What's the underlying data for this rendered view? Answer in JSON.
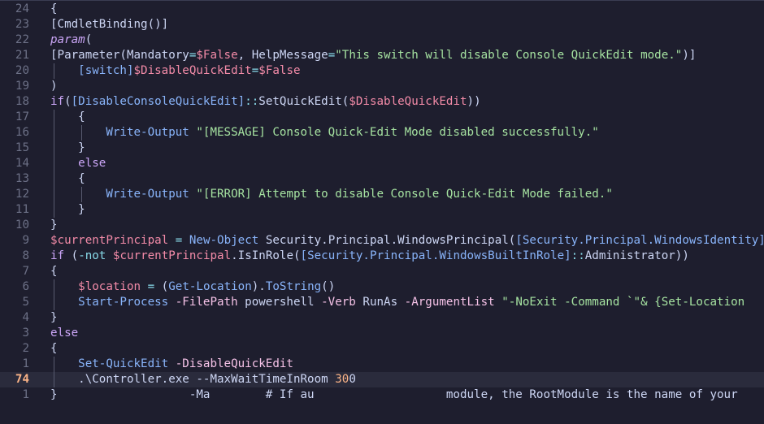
{
  "editor": {
    "colors": {
      "background": "#1e1e2e",
      "keyword": "#cba6f7",
      "type": "#89b4fa",
      "variable": "#f38ba8",
      "string": "#a6e3a1",
      "number": "#fab387",
      "current_line": "#2a2b3c"
    },
    "lines": [
      {
        "num": "24",
        "guides": [],
        "tokens": [
          {
            "t": "{",
            "c": "plain"
          }
        ]
      },
      {
        "num": "23",
        "guides": [],
        "tokens": [
          {
            "t": "[CmdletBinding()]",
            "c": "plain"
          }
        ]
      },
      {
        "num": "22",
        "guides": [],
        "tokens": [
          {
            "t": "param",
            "c": "kwi"
          },
          {
            "t": "(",
            "c": "plain"
          }
        ]
      },
      {
        "num": "21",
        "guides": [],
        "tokens": [
          {
            "t": "[Parameter(Mandatory",
            "c": "plain"
          },
          {
            "t": "=",
            "c": "op"
          },
          {
            "t": "$False",
            "c": "var"
          },
          {
            "t": ", HelpMessage",
            "c": "plain"
          },
          {
            "t": "=",
            "c": "op"
          },
          {
            "t": "\"This switch will disable Console QuickEdit mode.\"",
            "c": "str"
          },
          {
            "t": ")]",
            "c": "plain"
          }
        ]
      },
      {
        "num": "20",
        "guides": [
          1
        ],
        "tokens": [
          {
            "t": "    ",
            "c": "plain"
          },
          {
            "t": "[switch]",
            "c": "type"
          },
          {
            "t": "$DisableQuickEdit",
            "c": "var"
          },
          {
            "t": "=",
            "c": "op"
          },
          {
            "t": "$False",
            "c": "var"
          }
        ]
      },
      {
        "num": "19",
        "guides": [],
        "tokens": [
          {
            "t": ")",
            "c": "plain"
          }
        ]
      },
      {
        "num": "18",
        "guides": [],
        "tokens": [
          {
            "t": "if",
            "c": "kw"
          },
          {
            "t": "(",
            "c": "plain"
          },
          {
            "t": "[DisableConsoleQuickEdit]",
            "c": "type"
          },
          {
            "t": "::",
            "c": "op"
          },
          {
            "t": "SetQuickEdit(",
            "c": "plain"
          },
          {
            "t": "$DisableQuickEdit",
            "c": "var"
          },
          {
            "t": "))",
            "c": "plain"
          }
        ]
      },
      {
        "num": "17",
        "guides": [
          1
        ],
        "tokens": [
          {
            "t": "    {",
            "c": "plain"
          }
        ]
      },
      {
        "num": "16",
        "guides": [
          1,
          2
        ],
        "tokens": [
          {
            "t": "        ",
            "c": "plain"
          },
          {
            "t": "Write-Output",
            "c": "cmd"
          },
          {
            "t": " ",
            "c": "plain"
          },
          {
            "t": "\"[MESSAGE] Console Quick-Edit Mode disabled successfully.\"",
            "c": "str"
          }
        ]
      },
      {
        "num": "15",
        "guides": [
          1
        ],
        "tokens": [
          {
            "t": "    }",
            "c": "plain"
          }
        ]
      },
      {
        "num": "14",
        "guides": [
          1
        ],
        "tokens": [
          {
            "t": "    ",
            "c": "plain"
          },
          {
            "t": "else",
            "c": "kw"
          }
        ]
      },
      {
        "num": "13",
        "guides": [
          1
        ],
        "tokens": [
          {
            "t": "    {",
            "c": "plain"
          }
        ]
      },
      {
        "num": "12",
        "guides": [
          1,
          2
        ],
        "tokens": [
          {
            "t": "        ",
            "c": "plain"
          },
          {
            "t": "Write-Output",
            "c": "cmd"
          },
          {
            "t": " ",
            "c": "plain"
          },
          {
            "t": "\"[ERROR] Attempt to disable Console Quick-Edit Mode failed.\"",
            "c": "str"
          }
        ]
      },
      {
        "num": "11",
        "guides": [
          1
        ],
        "tokens": [
          {
            "t": "    }",
            "c": "plain"
          }
        ]
      },
      {
        "num": "10",
        "guides": [],
        "tokens": [
          {
            "t": "}",
            "c": "plain"
          }
        ]
      },
      {
        "num": "9",
        "guides": [],
        "tokens": [
          {
            "t": "$currentPrincipal",
            "c": "var"
          },
          {
            "t": " ",
            "c": "plain"
          },
          {
            "t": "=",
            "c": "op"
          },
          {
            "t": " ",
            "c": "plain"
          },
          {
            "t": "New-Object",
            "c": "cmd"
          },
          {
            "t": " Security.Principal.WindowsPrincipal(",
            "c": "plain"
          },
          {
            "t": "[Security.Principal.WindowsIdentity]",
            "c": "type"
          }
        ]
      },
      {
        "num": "8",
        "guides": [],
        "tokens": [
          {
            "t": "if",
            "c": "kw"
          },
          {
            "t": " (",
            "c": "plain"
          },
          {
            "t": "-not",
            "c": "op"
          },
          {
            "t": " ",
            "c": "plain"
          },
          {
            "t": "$currentPrincipal",
            "c": "var"
          },
          {
            "t": ".IsInRole(",
            "c": "plain"
          },
          {
            "t": "[Security.Principal.WindowsBuiltInRole]",
            "c": "type"
          },
          {
            "t": "::",
            "c": "op"
          },
          {
            "t": "Administrator))",
            "c": "plain"
          }
        ]
      },
      {
        "num": "7",
        "guides": [],
        "tokens": [
          {
            "t": "{",
            "c": "plain"
          }
        ]
      },
      {
        "num": "6",
        "guides": [
          1
        ],
        "tokens": [
          {
            "t": "    ",
            "c": "plain"
          },
          {
            "t": "$location",
            "c": "var"
          },
          {
            "t": " ",
            "c": "plain"
          },
          {
            "t": "=",
            "c": "op"
          },
          {
            "t": " (",
            "c": "plain"
          },
          {
            "t": "Get-Location",
            "c": "cmd"
          },
          {
            "t": ").",
            "c": "plain"
          },
          {
            "t": "ToString",
            "c": "cmd"
          },
          {
            "t": "()",
            "c": "plain"
          }
        ]
      },
      {
        "num": "5",
        "guides": [
          1
        ],
        "tokens": [
          {
            "t": "    ",
            "c": "plain"
          },
          {
            "t": "Start-Process",
            "c": "cmd"
          },
          {
            "t": " ",
            "c": "plain"
          },
          {
            "t": "-FilePath",
            "c": "param"
          },
          {
            "t": " powershell ",
            "c": "plain"
          },
          {
            "t": "-Verb",
            "c": "param"
          },
          {
            "t": " RunAs ",
            "c": "plain"
          },
          {
            "t": "-ArgumentList",
            "c": "param"
          },
          {
            "t": " ",
            "c": "plain"
          },
          {
            "t": "\"-NoExit -Command `\"& {Set-Location",
            "c": "str"
          }
        ]
      },
      {
        "num": "4",
        "guides": [],
        "tokens": [
          {
            "t": "}",
            "c": "plain"
          }
        ]
      },
      {
        "num": "3",
        "guides": [],
        "tokens": [
          {
            "t": "else",
            "c": "kw"
          }
        ]
      },
      {
        "num": "2",
        "guides": [],
        "tokens": [
          {
            "t": "{",
            "c": "plain"
          }
        ]
      },
      {
        "num": "1",
        "guides": [
          1
        ],
        "tokens": [
          {
            "t": "    ",
            "c": "plain"
          },
          {
            "t": "Set-QuickEdit",
            "c": "cmd"
          },
          {
            "t": " ",
            "c": "plain"
          },
          {
            "t": "-DisableQuickEdit",
            "c": "param"
          }
        ]
      },
      {
        "num": "74",
        "current": true,
        "guides": [
          1
        ],
        "tokens": [
          {
            "t": "    .\\Controller.exe --MaxWaitTimeInRoom ",
            "c": "plain"
          },
          {
            "t": "30",
            "c": "num"
          },
          {
            "t": "0",
            "c": "cursor"
          }
        ]
      },
      {
        "num": "1",
        "guides": [],
        "tokens": [
          {
            "t": "}                   -Ma        # If au                   module, the RootModule is the name of your",
            "c": "plain"
          }
        ]
      }
    ]
  }
}
